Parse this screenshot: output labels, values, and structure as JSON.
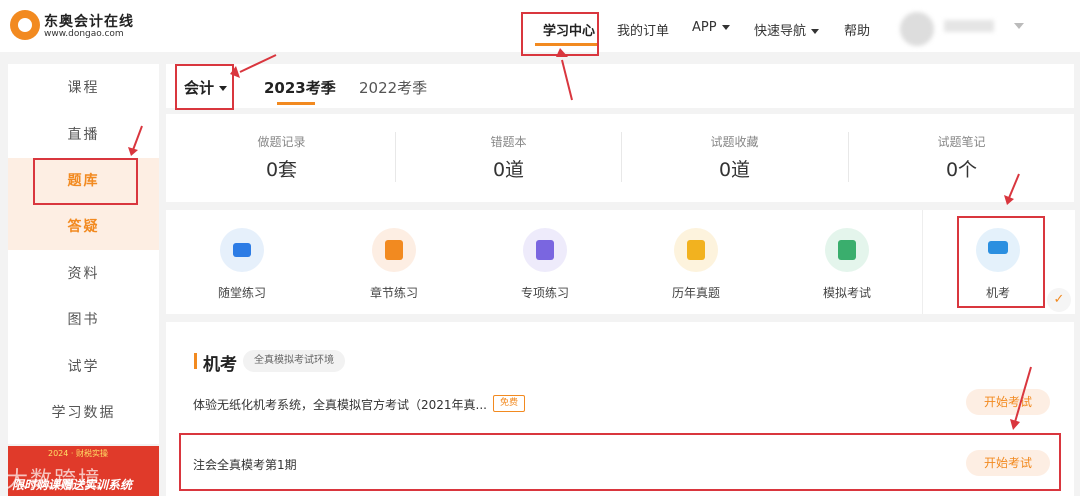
{
  "header": {
    "logo_title": "东奥会计在线",
    "logo_url": "www.dongao.com",
    "nav": [
      {
        "label": "学习中心",
        "active": true
      },
      {
        "label": "我的订单"
      },
      {
        "label": "APP",
        "dropdown": true
      },
      {
        "label": "快速导航",
        "dropdown": true
      },
      {
        "label": "帮助"
      }
    ]
  },
  "sidebar": {
    "items": [
      {
        "label": "课程"
      },
      {
        "label": "直播"
      },
      {
        "label": "题库",
        "active": true
      },
      {
        "label": "答疑"
      },
      {
        "label": "资料"
      },
      {
        "label": "图书"
      },
      {
        "label": "试学"
      },
      {
        "label": "学习数据"
      }
    ],
    "banner_tag": "2024 · 财税实操",
    "banner_text": "限时购课赠送实训系统",
    "watermark": "大数跨境"
  },
  "tabs": {
    "subject": "会计",
    "items": [
      "2023考季",
      "2022考季"
    ]
  },
  "stats": [
    {
      "label": "做题记录",
      "value": "0套"
    },
    {
      "label": "错题本",
      "value": "0道"
    },
    {
      "label": "试题收藏",
      "value": "0道"
    },
    {
      "label": "试题笔记",
      "value": "0个"
    }
  ],
  "practice": [
    {
      "label": "随堂练习",
      "icon": "video-icon",
      "bg": "#e6f0fb",
      "fg": "#2d7ce5"
    },
    {
      "label": "章节练习",
      "icon": "book-icon",
      "bg": "#fdeee3",
      "fg": "#f28a20"
    },
    {
      "label": "专项练习",
      "icon": "checklist-icon",
      "bg": "#eeebfb",
      "fg": "#7a66e0"
    },
    {
      "label": "历年真题",
      "icon": "star-icon",
      "bg": "#fdf3dd",
      "fg": "#f2b21f"
    },
    {
      "label": "模拟考试",
      "icon": "clipboard-icon",
      "bg": "#e4f5ec",
      "fg": "#3aae6d"
    },
    {
      "label": "机考",
      "icon": "monitor-icon",
      "bg": "#e4f1fb",
      "fg": "#2b8fe0",
      "selected": true
    }
  ],
  "machine": {
    "title": "机考",
    "tag": "全真模拟考试环境",
    "rows": [
      {
        "text": "体验无纸化机考系统，全真模拟官方考试（2021年真...",
        "badge": "免费",
        "button": "开始考试"
      },
      {
        "text": "注会全真模考第1期",
        "button": "开始考试"
      }
    ]
  },
  "colors": {
    "accent": "#f28a20",
    "annotation": "#d9363e"
  }
}
